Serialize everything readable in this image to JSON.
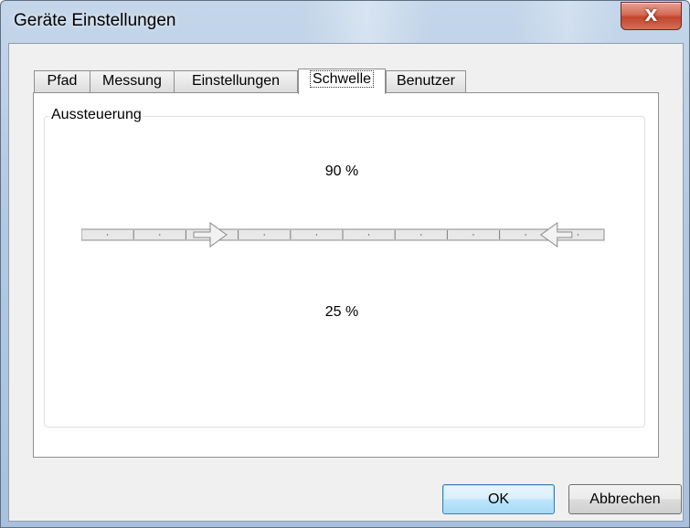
{
  "window": {
    "title": "Geräte Einstellungen",
    "close_symbol": "X"
  },
  "tabs": [
    {
      "label": "Pfad"
    },
    {
      "label": "Messung"
    },
    {
      "label": "Einstellungen"
    },
    {
      "label": "Schwelle",
      "selected": true
    },
    {
      "label": "Benutzer"
    }
  ],
  "group": {
    "title": "Aussteuerung",
    "top_value_label": "90 %",
    "bottom_value_label": "25 %"
  },
  "slider": {
    "min_percent": 0,
    "max_percent": 100,
    "lower_thumb_percent": 25,
    "upper_thumb_percent": 90
  },
  "buttons": {
    "ok": "OK",
    "cancel": "Abbrechen"
  },
  "colors": {
    "default_button": "#3c7fb1",
    "close_button": "#c1452d"
  }
}
